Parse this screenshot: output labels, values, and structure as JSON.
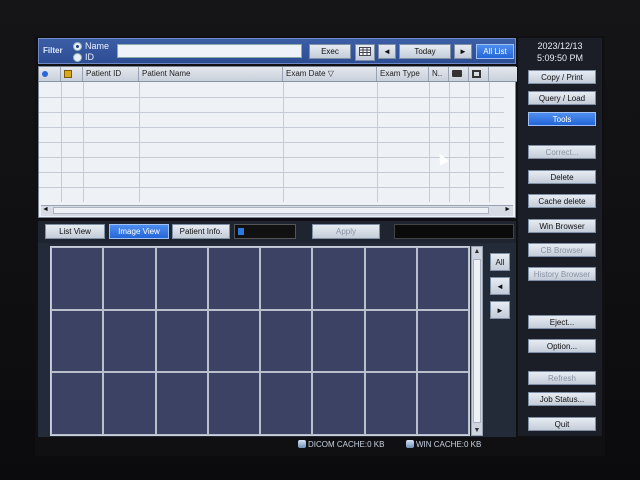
{
  "filter": {
    "label": "Filter",
    "options": [
      "Name",
      "ID"
    ],
    "selected": "Name",
    "value": "",
    "exec_label": "Exec",
    "today_label": "Today",
    "all_list_label": "All List",
    "prev_icon": "left-arrow",
    "next_icon": "right-arrow",
    "calendar_icon": "calendar-grid"
  },
  "list": {
    "columns": [
      "",
      "",
      "Patient ID",
      "Patient Name",
      "Exam Date ▽",
      "Exam Type",
      "N..",
      "",
      ""
    ],
    "rows": []
  },
  "view_tabs": {
    "list_view": "List View",
    "image_view": "Image View",
    "patient_info": "Patient Info.",
    "apply": "Apply",
    "active": "Image View"
  },
  "grid": {
    "all_label": "All",
    "prev_label": "◄",
    "next_label": "►"
  },
  "right_panel": {
    "date": "2023/12/13",
    "time": "5:09:50 PM",
    "buttons": [
      "Copy / Print",
      "Query / Load",
      "Tools",
      "Correct...",
      "Delete",
      "Cache delete",
      "Win Browser",
      "CB Browser",
      "History Browser",
      "Eject...",
      "Option...",
      "Refresh",
      "Job Status...",
      "Quit"
    ],
    "active": "Tools",
    "disabled": [
      "Correct...",
      "CB Browser",
      "History Browser",
      "Refresh"
    ]
  },
  "status": {
    "dicom_cache": "DICOM CACHE:0 KB",
    "win_cache": "WIN CACHE:0 KB"
  },
  "colors": {
    "accent": "#2466d8",
    "bar": "#2d4d93",
    "cell": "#3b4263"
  }
}
